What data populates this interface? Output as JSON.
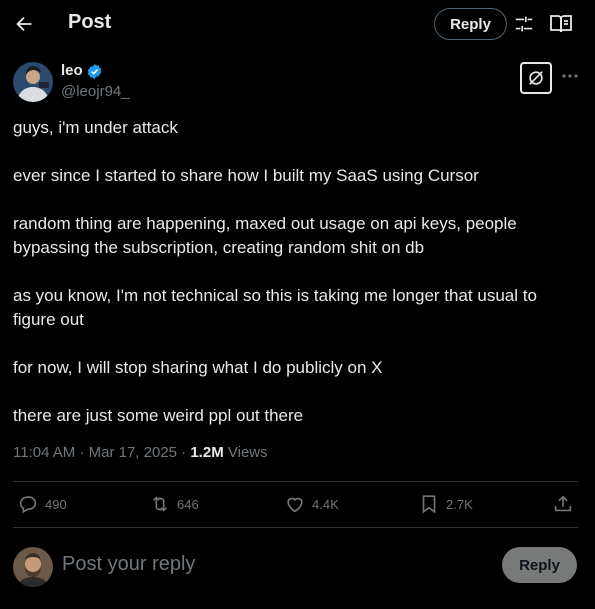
{
  "header": {
    "title": "Post",
    "reply_label": "Reply",
    "icons": [
      "back-arrow-icon",
      "tune-icon",
      "reader-icon"
    ]
  },
  "author": {
    "name": "leo",
    "handle": "@leojr94_",
    "verified": true,
    "verified_color": "#1d9bf0"
  },
  "post": {
    "paragraphs": [
      "guys, i'm under attack",
      "ever since I started to share how I built my SaaS using Cursor",
      "random thing are happening, maxed out usage on api keys, people bypassing the subscription, creating random shit on db",
      "as you know, I'm not technical so this is taking me longer that usual to figure out",
      "for now, I will stop sharing what I do publicly on X",
      "there are just some weird ppl out there"
    ],
    "time": "11:04 AM",
    "date": "Mar 17, 2025",
    "views_count": "1.2M",
    "views_label": "Views"
  },
  "actions": {
    "replies": "490",
    "reposts": "646",
    "likes": "4.4K",
    "bookmarks": "2.7K"
  },
  "reply_box": {
    "placeholder": "Post your reply",
    "submit_label": "Reply"
  },
  "colors": {
    "background": "#000000",
    "text": "#e7e9ea",
    "muted": "#71767b",
    "divider": "#2f3336"
  }
}
